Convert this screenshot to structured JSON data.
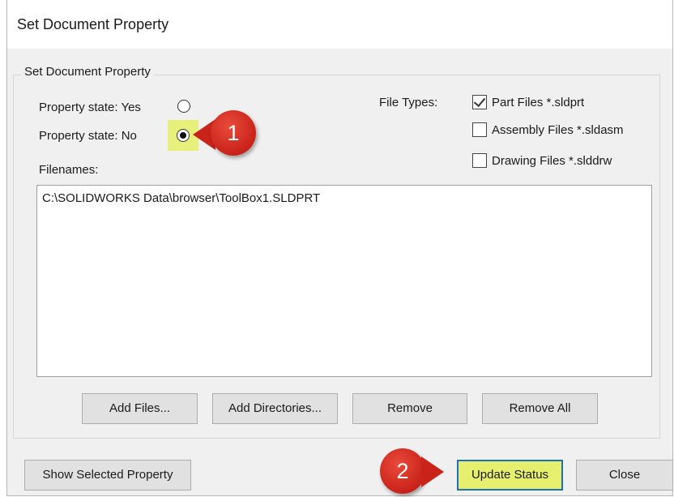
{
  "window": {
    "title": "Set Document Property"
  },
  "group": {
    "legend": "Set Document Property",
    "property_yes_label": "Property state: Yes",
    "property_no_label": "Property state: No",
    "selected_state": "No",
    "file_types_label": "File Types:",
    "file_types": [
      {
        "label": "Part Files *.sldprt",
        "checked": true
      },
      {
        "label": "Assembly Files *.sldasm",
        "checked": false
      },
      {
        "label": "Drawing Files *.slddrw",
        "checked": false
      }
    ],
    "filenames_label": "Filenames:",
    "filenames": [
      "C:\\SOLIDWORKS Data\\browser\\ToolBox1.SLDPRT"
    ],
    "buttons": {
      "add_files": "Add Files...",
      "add_directories": "Add Directories...",
      "remove": "Remove",
      "remove_all": "Remove All"
    }
  },
  "footer": {
    "show_selected": "Show Selected Property",
    "update_status": "Update Status",
    "close": "Close"
  },
  "callouts": {
    "one": "1",
    "two": "2"
  },
  "colors": {
    "highlight": "#e6f07a",
    "callout_red": "#d02b1f",
    "focus_border": "#1f6fb5"
  }
}
